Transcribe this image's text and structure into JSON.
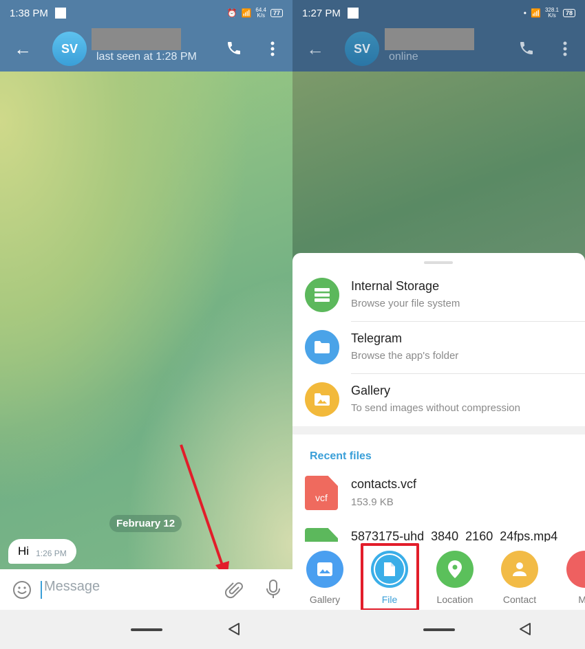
{
  "left": {
    "status": {
      "time": "1:38 PM",
      "speed": "64.4",
      "speed_unit": "K/s",
      "battery": "77"
    },
    "header": {
      "avatar": "SV",
      "subtitle": "last seen at 1:28 PM",
      "color": "#527ea5"
    },
    "date_label": "February 12",
    "message": {
      "text": "Hi",
      "time": "1:26 PM"
    },
    "input": {
      "placeholder": "Message"
    },
    "annotation_color": "#e21d2a"
  },
  "right": {
    "status": {
      "time": "1:27 PM",
      "speed": "328.1",
      "speed_unit": "K/s",
      "battery": "78"
    },
    "header": {
      "avatar": "SV",
      "subtitle": "online",
      "color": "#3e6284"
    },
    "options": [
      {
        "title": "Internal Storage",
        "desc": "Browse your file system",
        "icon": "storage-icon",
        "color": "#5cb85c"
      },
      {
        "title": "Telegram",
        "desc": "Browse the app's folder",
        "icon": "folder-icon",
        "color": "#4aa3e8"
      },
      {
        "title": "Gallery",
        "desc": "To send images without compression",
        "icon": "image-folder-icon",
        "color": "#f2b93b"
      }
    ],
    "recent_label": "Recent files",
    "files": [
      {
        "name": "contacts.vcf",
        "size": "153.9 KB",
        "ext": "vcf",
        "color": "#ef6a5e"
      },
      {
        "name": "5873175-uhd_3840_2160_24fps.mp4",
        "size": "",
        "ext": "",
        "color": "#5cb85c"
      }
    ],
    "attach": [
      {
        "label": "Gallery",
        "color": "#4a9ff0",
        "icon": "gallery-icon"
      },
      {
        "label": "File",
        "color": "#3aaee8",
        "icon": "file-icon",
        "selected": true
      },
      {
        "label": "Location",
        "color": "#5bc05b",
        "icon": "location-icon"
      },
      {
        "label": "Contact",
        "color": "#f2bb46",
        "icon": "contact-icon"
      },
      {
        "label": "Mu",
        "color": "#ee6060",
        "icon": "music-icon"
      }
    ]
  }
}
